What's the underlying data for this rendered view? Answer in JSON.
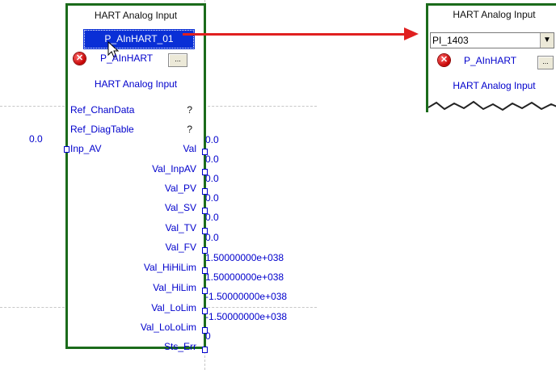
{
  "block": {
    "title": "HART Analog Input",
    "tag": "P_AInHART_01",
    "type_name": "P_AInHART",
    "description": "HART Analog Input",
    "ellipsis": "...",
    "inout_params": [
      {
        "name": "Ref_ChanData",
        "value": "?"
      },
      {
        "name": "Ref_DiagTable",
        "value": "?"
      }
    ],
    "input": {
      "name": "Inp_AV",
      "value": "0.0"
    },
    "outputs": [
      {
        "name": "Val",
        "value": "0.0"
      },
      {
        "name": "Val_InpAV",
        "value": "0.0"
      },
      {
        "name": "Val_PV",
        "value": "0.0"
      },
      {
        "name": "Val_SV",
        "value": "0.0"
      },
      {
        "name": "Val_TV",
        "value": "0.0"
      },
      {
        "name": "Val_FV",
        "value": "0.0"
      },
      {
        "name": "Val_HiHiLim",
        "value": "1.50000000e+038"
      },
      {
        "name": "Val_HiLim",
        "value": "1.50000000e+038"
      },
      {
        "name": "Val_LoLim",
        "value": "-1.50000000e+038"
      },
      {
        "name": "Val_LoLoLim",
        "value": "-1.50000000e+038"
      },
      {
        "name": "Sts_Err",
        "value": "0"
      }
    ]
  },
  "inset": {
    "title": "HART Analog Input",
    "tag_input": "PI_1403",
    "type_name": "P_AInHART",
    "description": "HART Analog Input"
  },
  "colors": {
    "block_border": "#1b6b1b",
    "selection": "#0a2fd6",
    "arrow": "#e02020",
    "value_text": "#0000cc"
  },
  "icons": {
    "error": "error-circle-x-icon",
    "dropdown": "chevron-down-icon",
    "pointer": "mouse-pointer-icon"
  }
}
